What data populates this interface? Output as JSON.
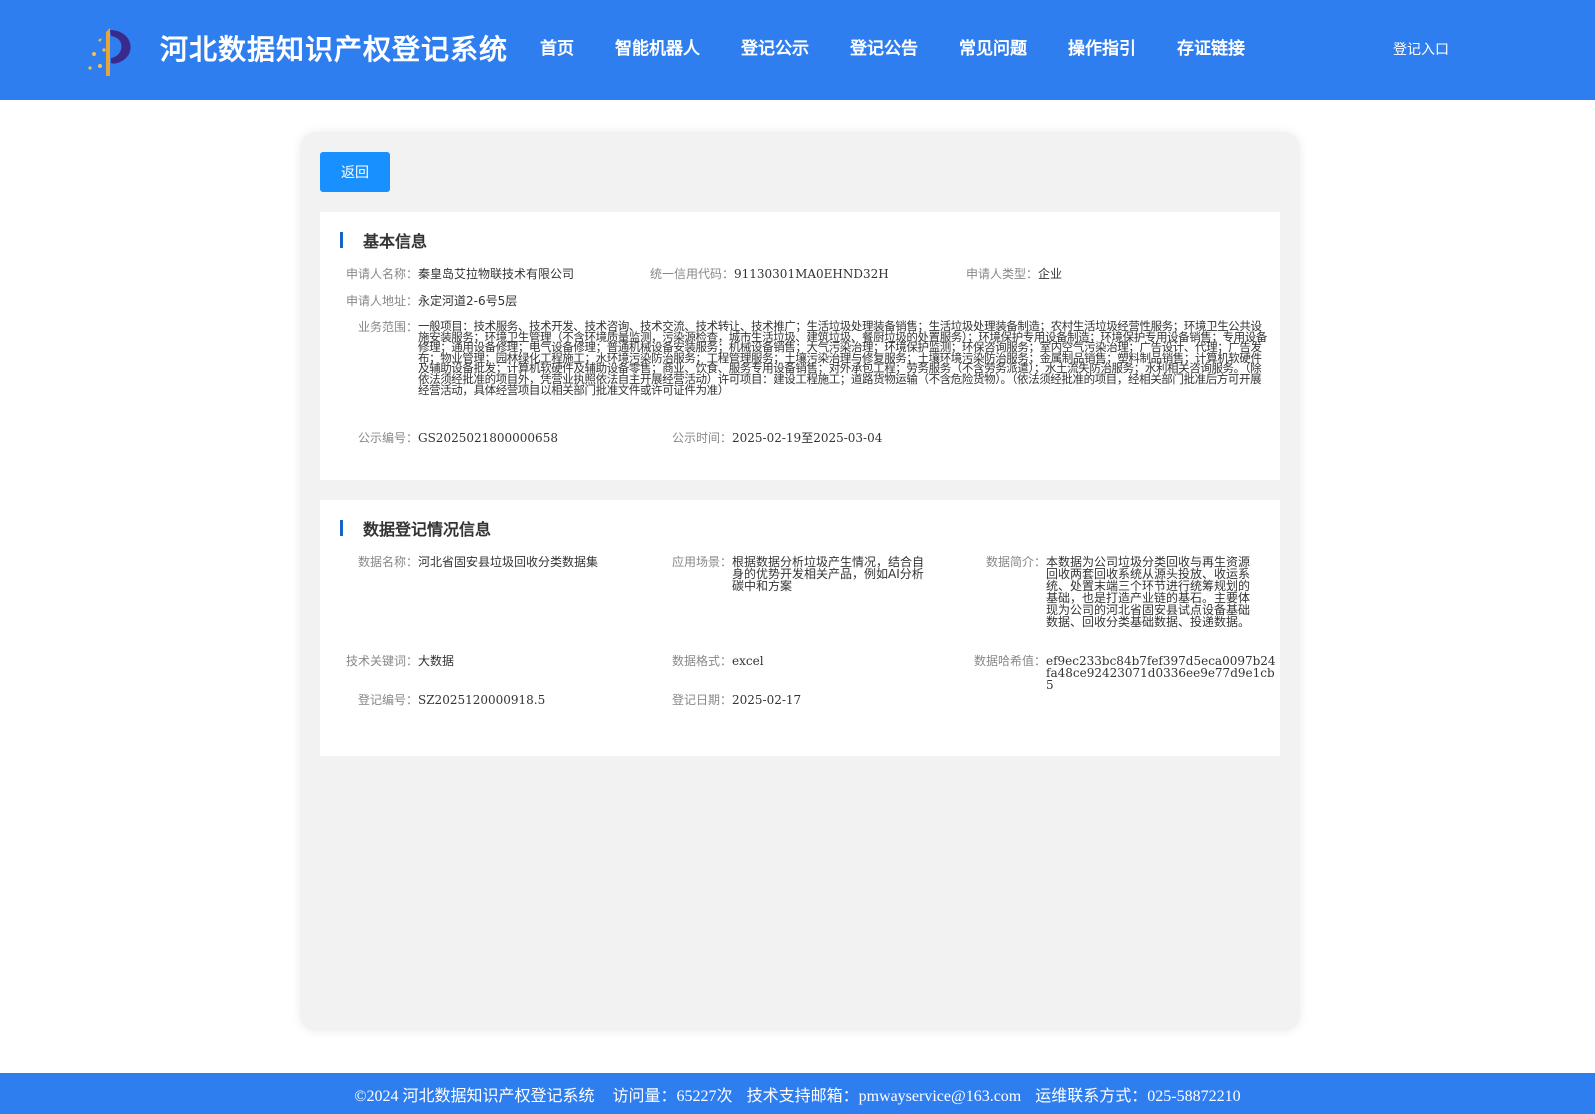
{
  "header": {
    "title": "河北数据知识产权登记系统",
    "nav": [
      "首页",
      "智能机器人",
      "登记公示",
      "登记公告",
      "常见问题",
      "操作指引",
      "存证链接"
    ],
    "login": "登记入口",
    "colors": {
      "primary": "#2f7ef0",
      "button": "#1890ff"
    }
  },
  "back_button": "返回",
  "basic": {
    "title": "基本信息",
    "applicant_name_label": "申请人名称：",
    "applicant_name": "秦皇岛艾拉物联技术有限公司",
    "credit_code_label": "统一信用代码：",
    "credit_code": "91130301MA0EHND32H",
    "applicant_type_label": "申请人类型：",
    "applicant_type": "企业",
    "address_label": "申请人地址：",
    "address": "永定河道2-6号5层",
    "scope_label": "业务范围：",
    "scope": "一般项目：技术服务、技术开发、技术咨询、技术交流、技术转让、技术推广；生活垃圾处理装备销售；生活垃圾处理装备制造；农村生活垃圾经营性服务；环境卫生公共设施安装服务；环境卫生管理（不含环境质量监测，污染源检查，城市生活垃圾、建筑垃圾、餐厨垃圾的处置服务）；环境保护专用设备制造；环境保护专用设备销售；专用设备修理；通用设备修理；电气设备修理；普通机械设备安装服务；机械设备销售；大气污染治理；环境保护监测；环保咨询服务；室内空气污染治理；广告设计、代理；广告发布；物业管理；园林绿化工程施工；水环境污染防治服务；工程管理服务；土壤污染治理与修复服务；土壤环境污染防治服务；金属制品销售；塑料制品销售；计算机软硬件及辅助设备批发；计算机软硬件及辅助设备零售；商业、饮食、服务专用设备销售；对外承包工程；劳务服务（不含劳务派遣）；水土流失防治服务；水利相关咨询服务。（除依法须经批准的项目外，凭营业执照依法自主开展经营活动）许可项目：建设工程施工；道路货物运输（不含危险货物）。（依法须经批准的项目，经相关部门批准后方可开展经营活动，具体经营项目以相关部门批准文件或许可证件为准）",
    "notice_no_label": "公示编号：",
    "notice_no": "GS2025021800000658",
    "notice_time_label": "公示时间：",
    "notice_time": "2025-02-19至2025-03-04"
  },
  "data_info": {
    "title": "数据登记情况信息",
    "name_label": "数据名称：",
    "name": "河北省固安县垃圾回收分类数据集",
    "scene_label": "应用场景：",
    "scene": "根据数据分析垃圾产生情况，结合自身的优势开发相关产品，例如AI分析碳中和方案",
    "intro_label": "数据简介：",
    "intro": "本数据为公司垃圾分类回收与再生资源回收两套回收系统从源头投放、收运系统、处置末端三个环节进行统筹规划的基础，也是打造产业链的基石。主要体现为公司的河北省固安县试点设备基础数据、回收分类基础数据、投递数据。",
    "keywords_label": "技术关键词：",
    "keywords": "大数据",
    "format_label": "数据格式：",
    "format": "excel",
    "hash_label": "数据哈希值：",
    "hash": "ef9ec233bc84b7fef397d5eca0097b24fa48ce92423071d0336ee9e77d9e1cb5",
    "reg_no_label": "登记编号：",
    "reg_no": "SZ2025120000918.5",
    "reg_date_label": "登记日期：",
    "reg_date": "2025-02-17"
  },
  "footer": {
    "copyright": "©2024 河北数据知识产权登记系统",
    "visits": "访问量：65227次",
    "email": "技术支持邮箱：pmwayservice@163.com",
    "contact": "运维联系方式：025-58872210"
  }
}
